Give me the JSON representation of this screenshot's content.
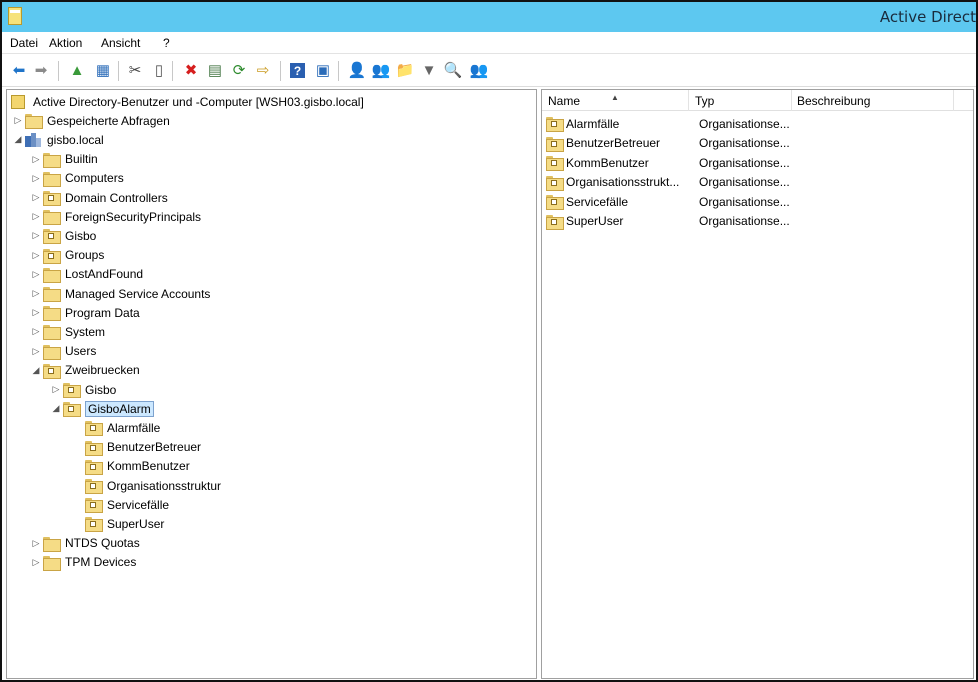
{
  "window": {
    "title": "Active Direct"
  },
  "menu": [
    "Datei",
    "Aktion",
    "Ansicht",
    "?"
  ],
  "toolbar": [
    {
      "name": "back-icon",
      "glyph": "⬅",
      "color": "#1f74c9"
    },
    {
      "name": "forward-icon",
      "glyph": "➡",
      "color": "#8a8a8a"
    },
    {
      "name": "up-folder-icon",
      "glyph": "▲",
      "color": "#3a9a3a"
    },
    {
      "name": "show-hide-console-tree-icon",
      "glyph": "▦",
      "color": "#2a6bb8"
    },
    {
      "name": "cut-icon",
      "glyph": "✂",
      "color": "#444"
    },
    {
      "name": "copy-icon",
      "glyph": "▯",
      "color": "#555"
    },
    {
      "name": "delete-icon",
      "glyph": "✖",
      "color": "#d61e1e"
    },
    {
      "name": "properties-icon",
      "glyph": "▤",
      "color": "#4a7a4a"
    },
    {
      "name": "refresh-icon",
      "glyph": "⟳",
      "color": "#2e8b2e"
    },
    {
      "name": "export-list-icon",
      "glyph": "⇨",
      "color": "#c99a1f"
    },
    {
      "name": "help-icon",
      "glyph": "?",
      "color": "#ffffff"
    },
    {
      "name": "action-pane-icon",
      "glyph": "▣",
      "color": "#2a6bb8"
    },
    {
      "name": "new-user-icon",
      "glyph": "👤",
      "color": "#3a6fb0"
    },
    {
      "name": "new-group-icon",
      "glyph": "👥",
      "color": "#3a6fb0"
    },
    {
      "name": "new-ou-icon",
      "glyph": "📁",
      "color": "#d8a52a"
    },
    {
      "name": "filter-icon",
      "glyph": "▼",
      "color": "#666"
    },
    {
      "name": "find-icon",
      "glyph": "🔍",
      "color": "#3a8a3a"
    },
    {
      "name": "add-to-group-icon",
      "glyph": "👥",
      "color": "#5a7a9a"
    }
  ],
  "tree": [
    {
      "label": "Active Directory-Benutzer und -Computer [WSH03.gisbo.local]",
      "level": 0,
      "exp": "",
      "icon": "root"
    },
    {
      "label": "Gespeicherte Abfragen",
      "level": 0,
      "exp": "▷",
      "icon": "folder"
    },
    {
      "label": "gisbo.local",
      "level": 0,
      "exp": "◢",
      "icon": "domain"
    },
    {
      "label": "Builtin",
      "level": 1,
      "exp": "▷",
      "icon": "folder"
    },
    {
      "label": "Computers",
      "level": 1,
      "exp": "▷",
      "icon": "folder"
    },
    {
      "label": "Domain Controllers",
      "level": 1,
      "exp": "▷",
      "icon": "ou"
    },
    {
      "label": "ForeignSecurityPrincipals",
      "level": 1,
      "exp": "▷",
      "icon": "folder"
    },
    {
      "label": "Gisbo",
      "level": 1,
      "exp": "▷",
      "icon": "ou"
    },
    {
      "label": "Groups",
      "level": 1,
      "exp": "▷",
      "icon": "ou"
    },
    {
      "label": "LostAndFound",
      "level": 1,
      "exp": "▷",
      "icon": "folder"
    },
    {
      "label": "Managed Service Accounts",
      "level": 1,
      "exp": "▷",
      "icon": "folder"
    },
    {
      "label": "Program Data",
      "level": 1,
      "exp": "▷",
      "icon": "folder"
    },
    {
      "label": "System",
      "level": 1,
      "exp": "▷",
      "icon": "folder"
    },
    {
      "label": "Users",
      "level": 1,
      "exp": "▷",
      "icon": "folder"
    },
    {
      "label": "Zweibruecken",
      "level": 1,
      "exp": "◢",
      "icon": "ou"
    },
    {
      "label": "Gisbo",
      "level": 2,
      "exp": "▷",
      "icon": "ou"
    },
    {
      "label": "GisboAlarm",
      "level": 2,
      "exp": "◢",
      "icon": "ou",
      "selected": true
    },
    {
      "label": "Alarmfälle",
      "level": 3,
      "exp": "",
      "icon": "ou"
    },
    {
      "label": "BenutzerBetreuer",
      "level": 3,
      "exp": "",
      "icon": "ou"
    },
    {
      "label": "KommBenutzer",
      "level": 3,
      "exp": "",
      "icon": "ou"
    },
    {
      "label": "Organisationsstruktur",
      "level": 3,
      "exp": "",
      "icon": "ou"
    },
    {
      "label": "Servicefälle",
      "level": 3,
      "exp": "",
      "icon": "ou"
    },
    {
      "label": "SuperUser",
      "level": 3,
      "exp": "",
      "icon": "ou"
    },
    {
      "label": "NTDS Quotas",
      "level": 1,
      "exp": "▷",
      "icon": "folder"
    },
    {
      "label": "TPM Devices",
      "level": 1,
      "exp": "▷",
      "icon": "folder"
    }
  ],
  "list": {
    "columns": [
      "Name",
      "Typ",
      "Beschreibung"
    ],
    "rows": [
      {
        "name": "Alarmfälle",
        "type": "Organisationse..."
      },
      {
        "name": "BenutzerBetreuer",
        "type": "Organisationse..."
      },
      {
        "name": "KommBenutzer",
        "type": "Organisationse..."
      },
      {
        "name": "Organisationsstrukt...",
        "type": "Organisationse..."
      },
      {
        "name": "Servicefälle",
        "type": "Organisationse..."
      },
      {
        "name": "SuperUser",
        "type": "Organisationse..."
      }
    ]
  }
}
